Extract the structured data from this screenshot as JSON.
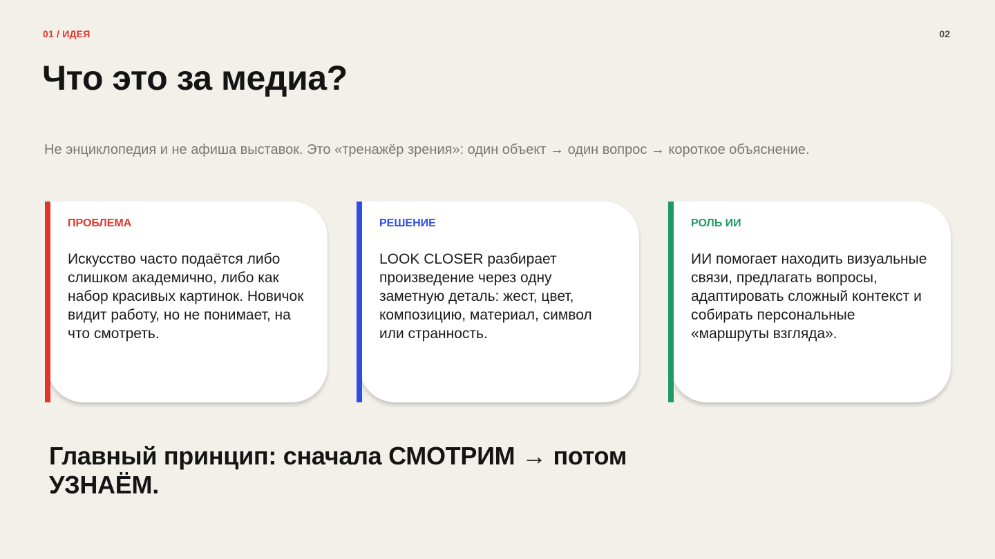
{
  "header": {
    "section_label": "01 / ИДЕЯ",
    "page_number": "02"
  },
  "title": "Что это за медиа?",
  "subtitle": "Не энциклопедия и не афиша выставок. Это «тренажёр зрения»: один объект → один вопрос → короткое объяснение.",
  "cards": [
    {
      "label": "ПРОБЛЕМА",
      "text": "Искусство часто подаётся либо слишком академично, либо как набор красивых картинок. Новичок видит работу, но не понимает, на что смотреть.",
      "accent": "#e0352b"
    },
    {
      "label": "РЕШЕНИЕ",
      "text": "LOOK CLOSER разбирает произведение через одну заметную деталь: жест, цвет, композицию, материал, символ или странность.",
      "accent": "#2f4de6"
    },
    {
      "label": "РОЛЬ ИИ",
      "text": "ИИ помогает находить визуальные связи, предлагать вопросы, адаптировать сложный контекст и собирать персональные «маршруты взгляда».",
      "accent": "#1f9a63"
    }
  ],
  "principle": "Главный принцип: сначала СМОТРИМ → потом УЗНАЁМ.",
  "colors": {
    "background": "#f3f0ea",
    "section_label": "#e0352b"
  }
}
